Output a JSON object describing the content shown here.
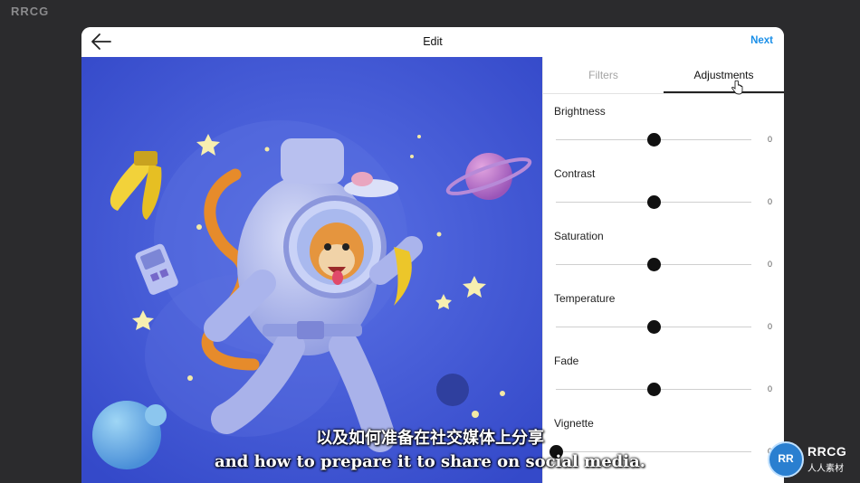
{
  "corner_logo": "RRCG",
  "header": {
    "title": "Edit",
    "next_label": "Next"
  },
  "tabs": {
    "filters": "Filters",
    "adjustments": "Adjustments",
    "active": "adjustments"
  },
  "adjustments": [
    {
      "label": "Brightness",
      "value": "0",
      "level": 0.5
    },
    {
      "label": "Contrast",
      "value": "0",
      "level": 0.5
    },
    {
      "label": "Saturation",
      "value": "0",
      "level": 0.5
    },
    {
      "label": "Temperature",
      "value": "0",
      "level": 0.5
    },
    {
      "label": "Fade",
      "value": "0",
      "level": 0.5
    },
    {
      "label": "Vignette",
      "value": "0",
      "level": 0.0
    }
  ],
  "subtitles": {
    "chinese": "以及如何准备在社交媒体上分享",
    "english": "and how to prepare it to share on social media."
  },
  "badge": {
    "initials": "RR",
    "line1": "RRCG",
    "line2": "人人素材"
  },
  "colors": {
    "accent": "#1a8fe8",
    "image_bg": "#3f5ad6",
    "knob": "#111111"
  }
}
